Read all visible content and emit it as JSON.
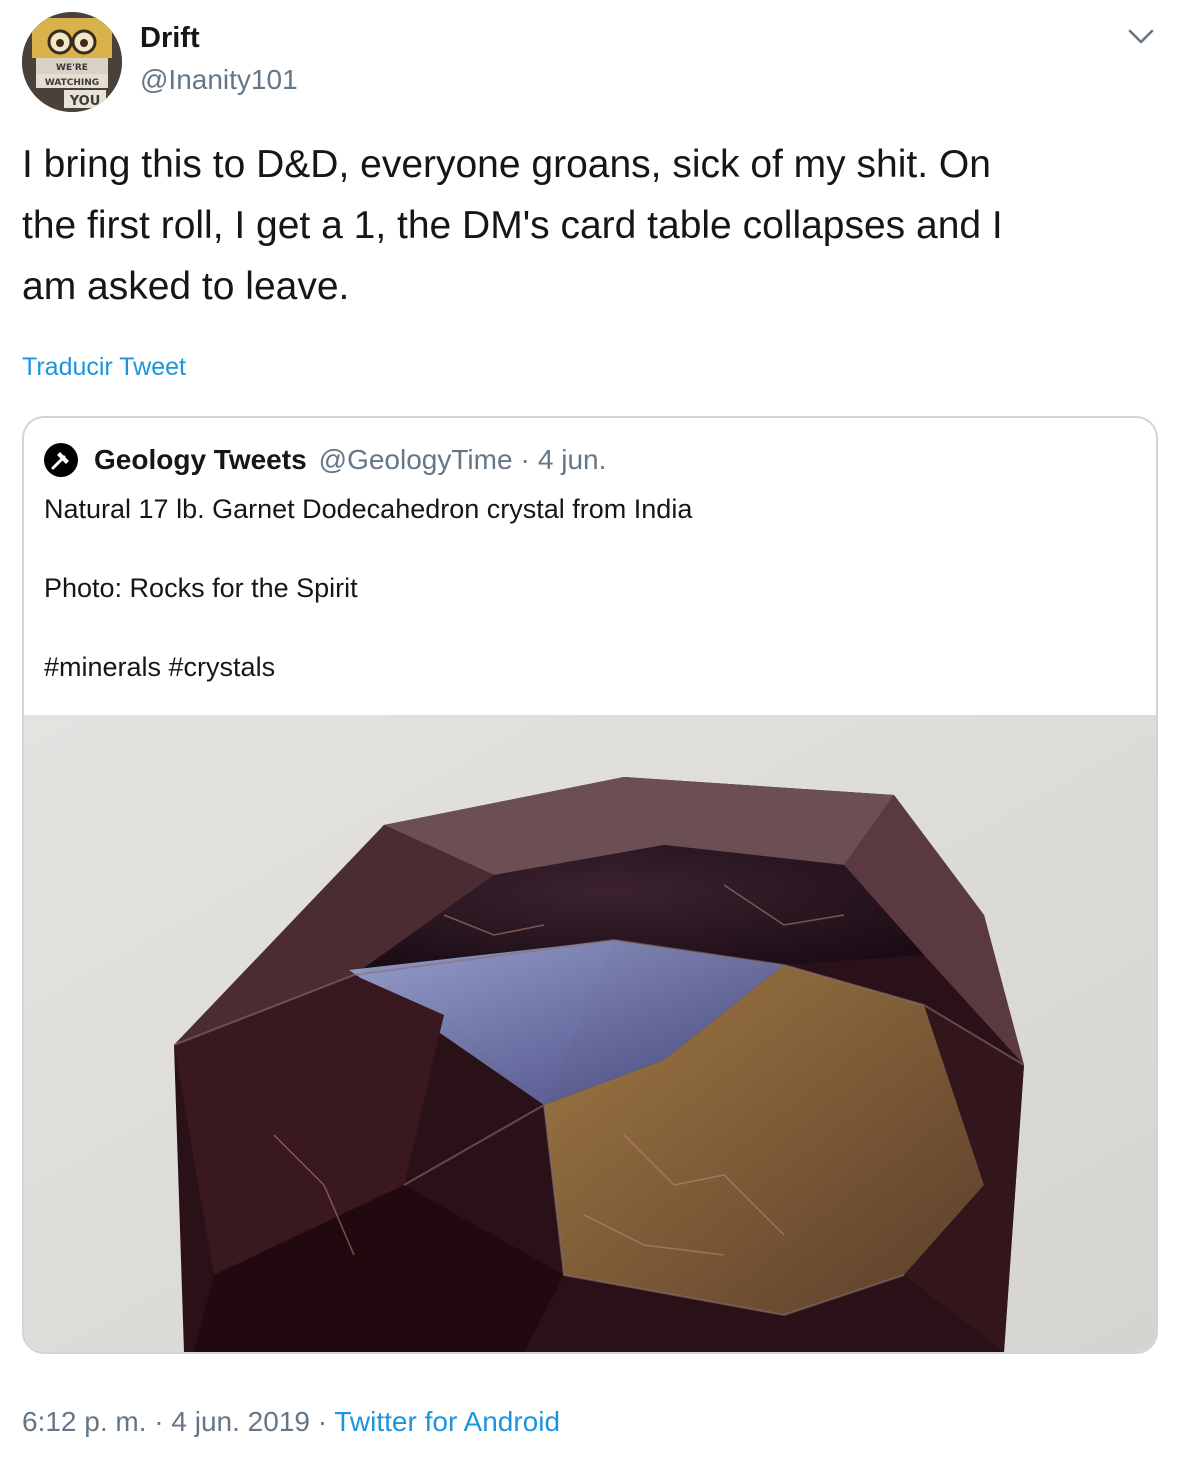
{
  "author": {
    "display_name": "Drift",
    "handle": "@Inanity101",
    "avatar_text": [
      "WE'RE",
      "WATCHING",
      "YOU"
    ]
  },
  "tweet": {
    "text": "I bring this to D&D, everyone groans, sick of my shit. On\nthe first roll, I get a 1, the DM's card table collapses and I\nam asked to leave.",
    "translate_label": "Traducir Tweet"
  },
  "quoted_tweet": {
    "display_name": "Geology Tweets",
    "handle": "@GeologyTime",
    "separator": "·",
    "date": "4 jun.",
    "lines": [
      "Natural 17 lb. Garnet Dodecahedron crystal from India",
      "Photo: Rocks for the Spirit",
      "#minerals #crystals"
    ]
  },
  "footer": {
    "time": "6:12 p. m.",
    "separator": "·",
    "date": "4 jun. 2019",
    "source": "Twitter for Android"
  },
  "colors": {
    "link": "#1b95e0",
    "secondary_text": "#657786",
    "border": "#ccd6dd"
  },
  "icons": {
    "menu": "chevron-down-icon",
    "quoted_avatar": "rock-hammer-icon"
  }
}
